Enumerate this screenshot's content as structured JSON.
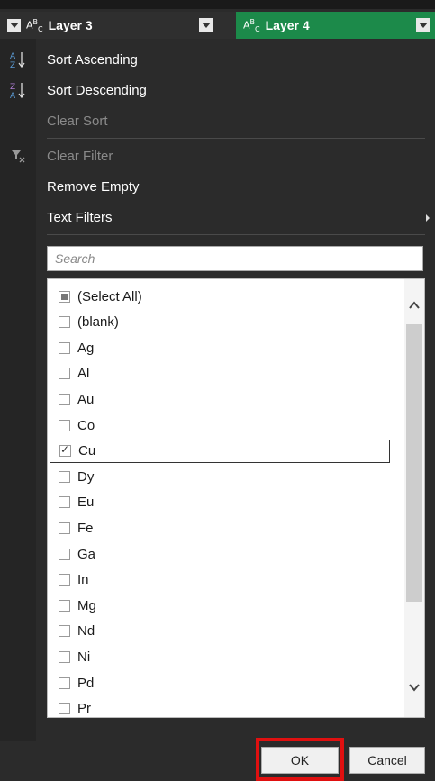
{
  "header": {
    "columns": [
      {
        "label": "Layer 3",
        "type_icon": "abc-text-icon"
      },
      {
        "label": "Layer 4",
        "type_icon": "abc-text-icon"
      }
    ],
    "active_color": "#1c8a4a"
  },
  "menu": {
    "sort_ascending": "Sort Ascending",
    "sort_descending": "Sort Descending",
    "clear_sort": "Clear Sort",
    "clear_filter": "Clear Filter",
    "remove_empty": "Remove Empty",
    "text_filters": "Text Filters"
  },
  "search": {
    "placeholder": "Search"
  },
  "list": {
    "items": [
      {
        "label": "(Select All)",
        "state": "partial"
      },
      {
        "label": "(blank)",
        "state": "unchecked"
      },
      {
        "label": "Ag",
        "state": "unchecked"
      },
      {
        "label": "Al",
        "state": "unchecked"
      },
      {
        "label": "Au",
        "state": "unchecked"
      },
      {
        "label": "Co",
        "state": "unchecked"
      },
      {
        "label": "Cu",
        "state": "checked"
      },
      {
        "label": "Dy",
        "state": "unchecked"
      },
      {
        "label": "Eu",
        "state": "unchecked"
      },
      {
        "label": "Fe",
        "state": "unchecked"
      },
      {
        "label": "Ga",
        "state": "unchecked"
      },
      {
        "label": "In",
        "state": "unchecked"
      },
      {
        "label": "Mg",
        "state": "unchecked"
      },
      {
        "label": "Nd",
        "state": "unchecked"
      },
      {
        "label": "Ni",
        "state": "unchecked"
      },
      {
        "label": "Pd",
        "state": "unchecked"
      },
      {
        "label": "Pr",
        "state": "unchecked"
      }
    ]
  },
  "buttons": {
    "ok": "OK",
    "cancel": "Cancel"
  },
  "highlight_color": "#e01010"
}
